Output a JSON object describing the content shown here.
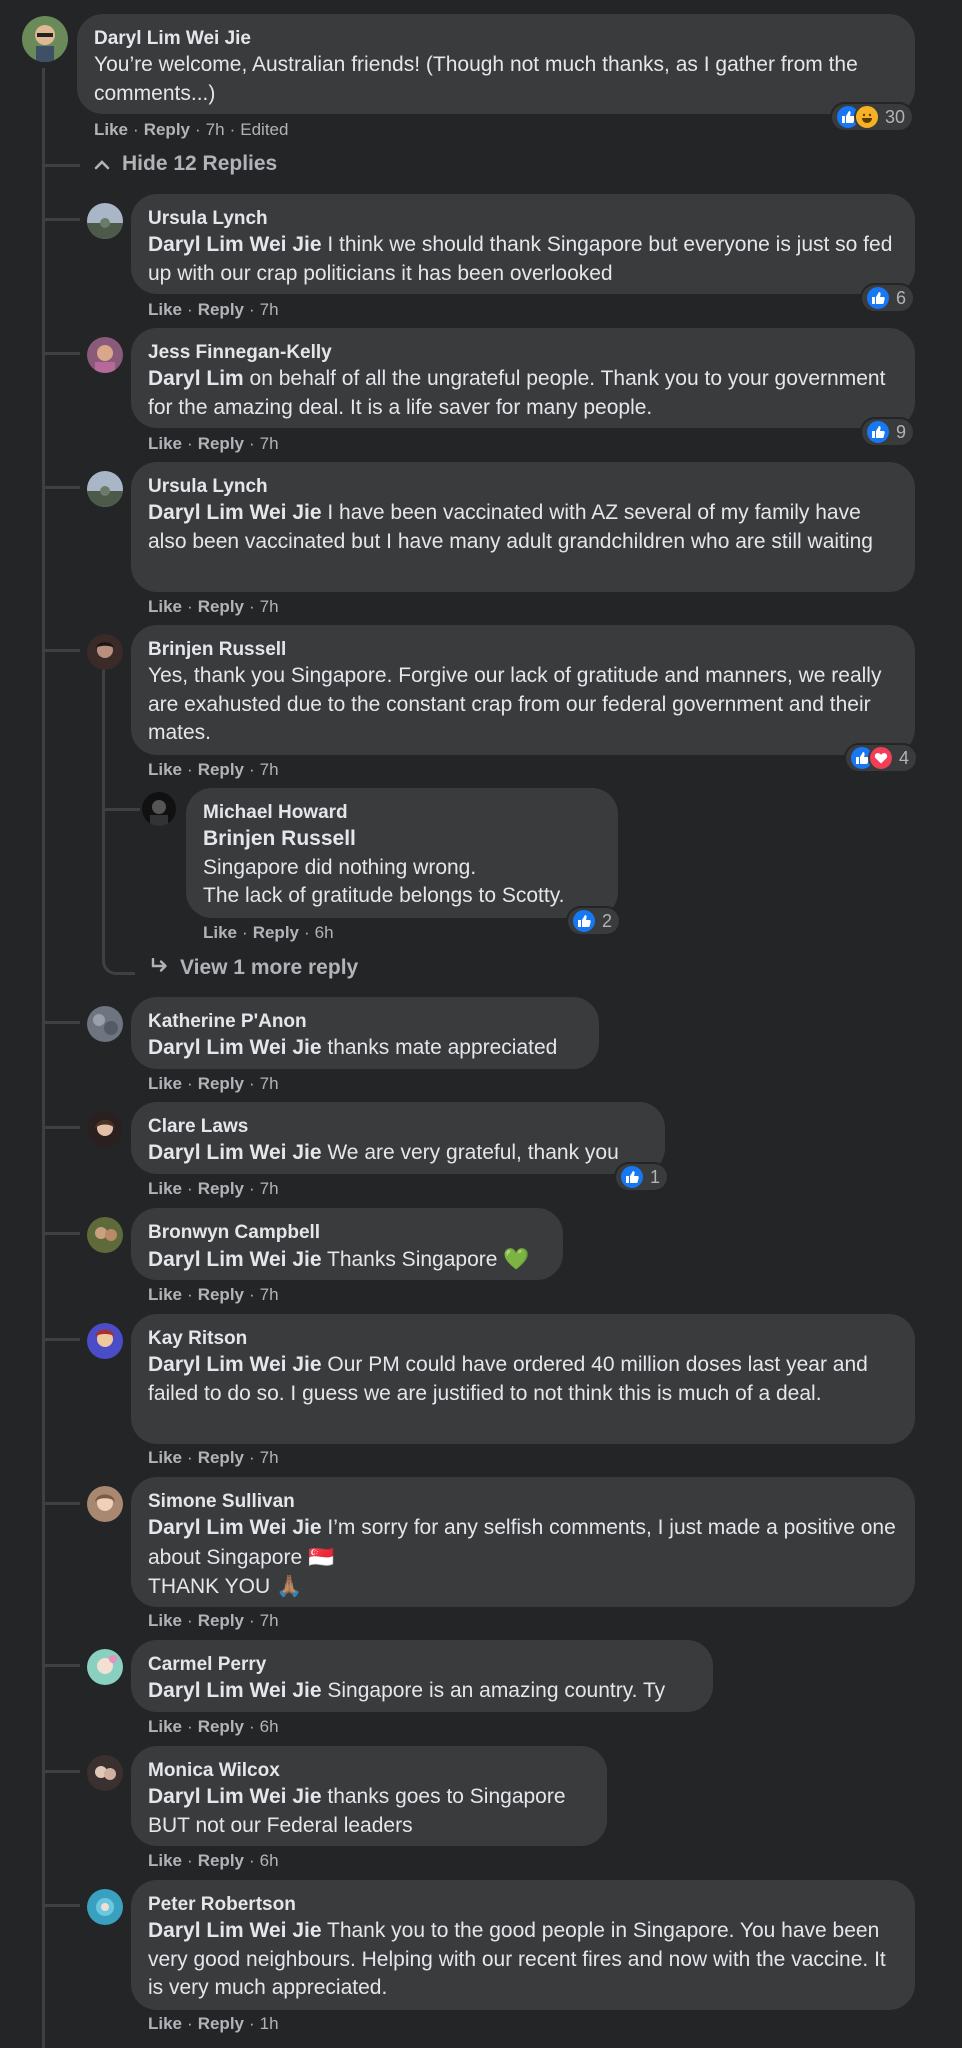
{
  "root": {
    "author": "Daryl Lim Wei Jie",
    "text": "You’re welcome, Australian friends! (Though not much thanks, as I gather from the comments...)",
    "like_label": "Like",
    "reply_label": "Reply",
    "time": "7h",
    "edited": "Edited",
    "reaction_count": "30"
  },
  "hide_replies_label": "Hide 12 Replies",
  "view_more_label": "View 1 more reply",
  "replies": [
    {
      "author": "Ursula Lynch",
      "mention": "Daryl Lim Wei Jie",
      "text": " I think we should thank Singapore but everyone is just so fed up with our crap politicians it has been overlooked",
      "like_label": "Like",
      "reply_label": "Reply",
      "time": "7h",
      "reaction_count": "6"
    },
    {
      "author": "Jess Finnegan-Kelly",
      "mention": "Daryl Lim",
      "text": " on behalf of all the ungrateful people. Thank you to your government for the amazing deal. It is a life saver for many people.",
      "like_label": "Like",
      "reply_label": "Reply",
      "time": "7h",
      "reaction_count": "9"
    },
    {
      "author": "Ursula Lynch",
      "mention": "Daryl Lim Wei Jie",
      "text": " I have been vaccinated with AZ several of my family have also been vaccinated but I have many adult grandchildren who are still waiting",
      "like_label": "Like",
      "reply_label": "Reply",
      "time": "7h"
    },
    {
      "author": "Brinjen Russell",
      "text": "Yes, thank you Singapore. Forgive our lack of gratitude and manners, we really are exahusted due to the constant crap from our federal government and their mates.",
      "like_label": "Like",
      "reply_label": "Reply",
      "time": "7h",
      "reaction_count": "4"
    },
    {
      "author": "Katherine P'Anon",
      "mention": "Daryl Lim Wei Jie",
      "text": " thanks mate appreciated",
      "like_label": "Like",
      "reply_label": "Reply",
      "time": "7h"
    },
    {
      "author": "Clare Laws",
      "mention": "Daryl Lim Wei Jie",
      "text": " We are very grateful, thank you",
      "like_label": "Like",
      "reply_label": "Reply",
      "time": "7h",
      "reaction_count": "1"
    },
    {
      "author": "Bronwyn Campbell",
      "mention": "Daryl Lim Wei Jie",
      "text": " Thanks Singapore ",
      "emoji": "💚",
      "like_label": "Like",
      "reply_label": "Reply",
      "time": "7h"
    },
    {
      "author": "Kay Ritson",
      "mention": "Daryl Lim Wei Jie",
      "text": " Our PM could have ordered 40 million doses last year and failed to do so. I guess we are justified to not think this is much of a deal.",
      "like_label": "Like",
      "reply_label": "Reply",
      "time": "7h"
    },
    {
      "author": "Simone Sullivan",
      "mention": "Daryl Lim Wei Jie",
      "text": " I’m sorry for any selfish comments, I just made a positive one about Singapore ",
      "emoji": "🇸🇬",
      "text2": "THANK YOU ",
      "emoji2": "🙏🏽",
      "like_label": "Like",
      "reply_label": "Reply",
      "time": "7h"
    },
    {
      "author": "Carmel Perry",
      "mention": "Daryl Lim Wei Jie",
      "text": " Singapore is an amazing country. Ty",
      "like_label": "Like",
      "reply_label": "Reply",
      "time": "6h"
    },
    {
      "author": "Monica Wilcox",
      "mention": "Daryl Lim Wei Jie",
      "text": " thanks goes to Singapore",
      "text2": "BUT not our Federal leaders",
      "like_label": "Like",
      "reply_label": "Reply",
      "time": "6h"
    },
    {
      "author": "Peter Robertson",
      "mention": "Daryl Lim Wei Jie",
      "text": " Thank you to the good people in Singapore. You have been very good neighbours. Helping with our recent fires and now with the vaccine. It is very much appreciated.",
      "like_label": "Like",
      "reply_label": "Reply",
      "time": "1h"
    }
  ],
  "nested_reply": {
    "author": "Michael Howard",
    "mention": "Brinjen Russell",
    "line1": "Singapore did nothing wrong.",
    "line2": "The lack of gratitude belongs to Scotty.",
    "like_label": "Like",
    "reply_label": "Reply",
    "time": "6h",
    "reaction_count": "2"
  },
  "colors": {
    "background": "#242526",
    "bubble": "#3a3b3c",
    "text": "#e4e6eb",
    "secondary": "#b0b3b8",
    "like_blue": "#1877f2",
    "love_red": "#f33e58"
  }
}
